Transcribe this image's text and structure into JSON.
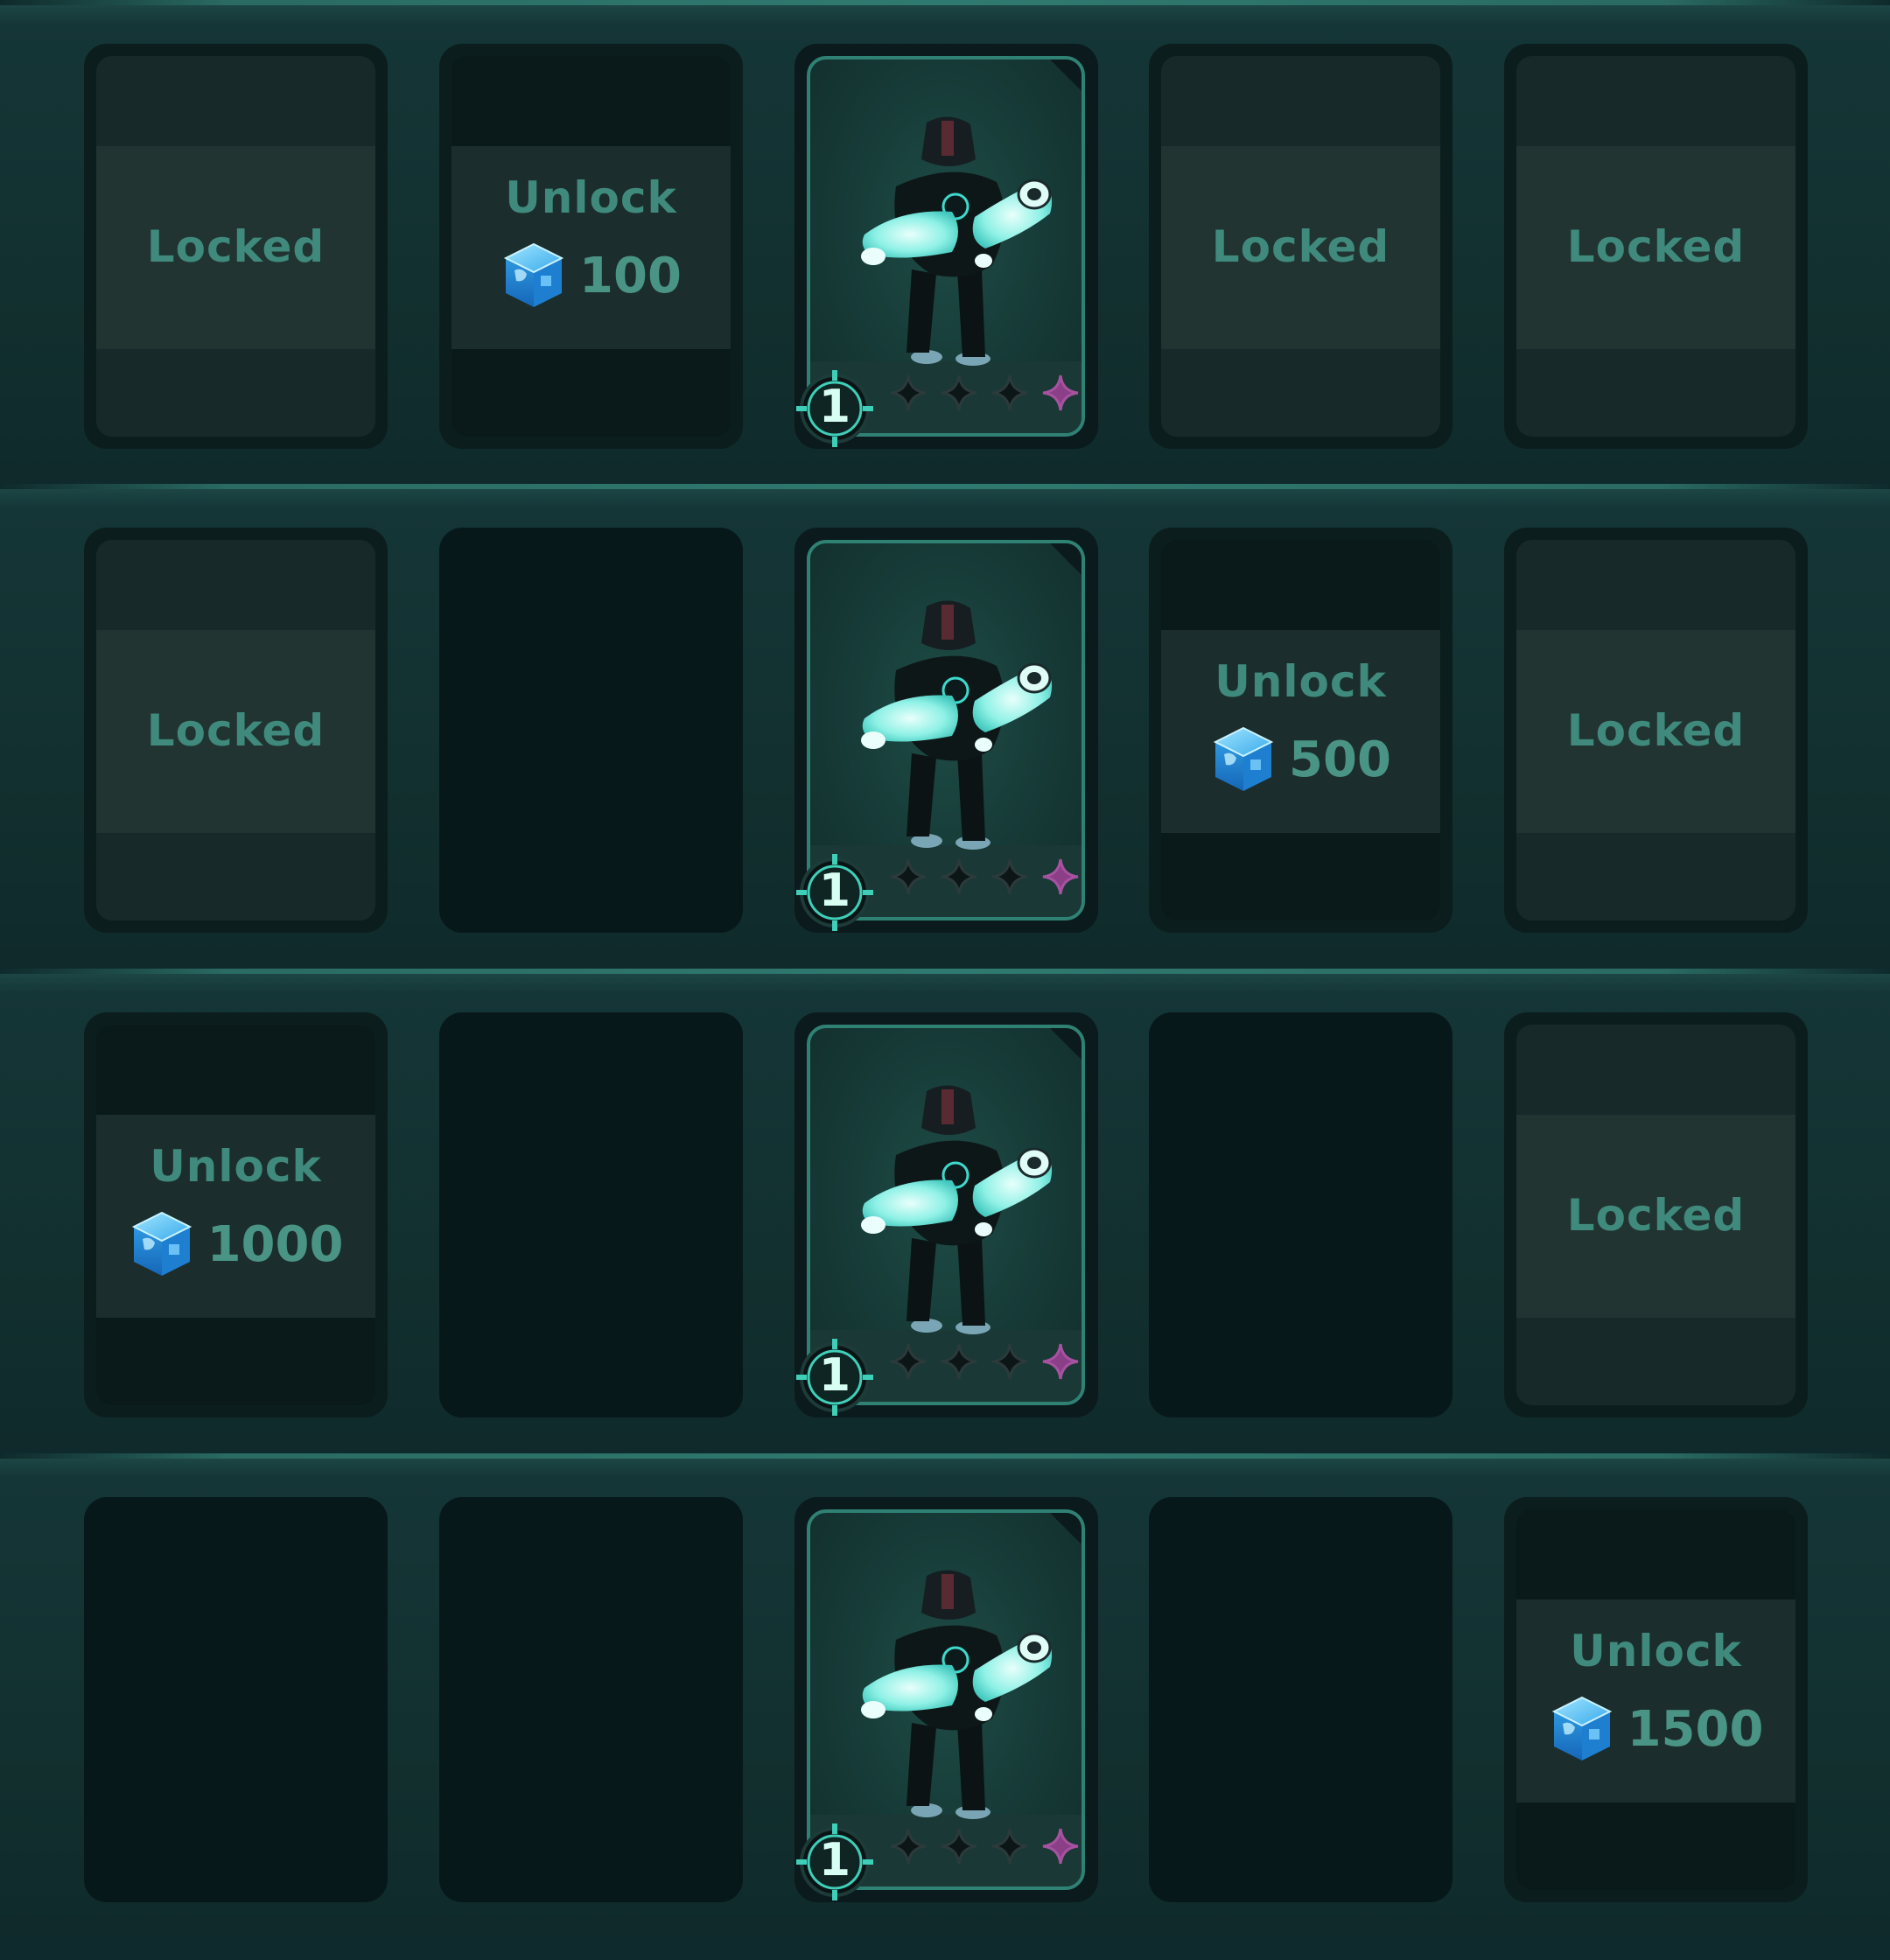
{
  "rows": [
    {
      "slots": [
        {
          "state": "locked",
          "label": "Locked"
        },
        {
          "state": "unlock",
          "label": "Unlock",
          "cost": "100",
          "currency_icon": "blue-cube-gem-icon"
        },
        {
          "state": "hero",
          "level": "1",
          "stars_filled": 0,
          "stars_total": 4
        },
        {
          "state": "locked",
          "label": "Locked"
        },
        {
          "state": "locked",
          "label": "Locked"
        }
      ]
    },
    {
      "slots": [
        {
          "state": "locked",
          "label": "Locked"
        },
        {
          "state": "empty"
        },
        {
          "state": "hero",
          "level": "1",
          "stars_filled": 0,
          "stars_total": 4
        },
        {
          "state": "unlock",
          "label": "Unlock",
          "cost": "500",
          "currency_icon": "blue-cube-gem-icon"
        },
        {
          "state": "locked",
          "label": "Locked"
        }
      ]
    },
    {
      "slots": [
        {
          "state": "unlock",
          "label": "Unlock",
          "cost": "1000",
          "currency_icon": "blue-cube-gem-icon"
        },
        {
          "state": "empty"
        },
        {
          "state": "hero",
          "level": "1",
          "stars_filled": 0,
          "stars_total": 4
        },
        {
          "state": "empty"
        },
        {
          "state": "locked",
          "label": "Locked"
        }
      ]
    },
    {
      "slots": [
        {
          "state": "empty"
        },
        {
          "state": "empty"
        },
        {
          "state": "hero",
          "level": "1",
          "stars_filled": 0,
          "stars_total": 4
        },
        {
          "state": "empty"
        },
        {
          "state": "unlock",
          "label": "Unlock",
          "cost": "1500",
          "currency_icon": "blue-cube-gem-icon"
        }
      ]
    }
  ],
  "colors": {
    "background": "#0f2a2c",
    "label_text": "#3f8a7c",
    "card_border": "#2f8174",
    "gem_blue": "#3fb6f0",
    "star_dark": "#0c1617",
    "star_purple": "#8a3f86"
  }
}
